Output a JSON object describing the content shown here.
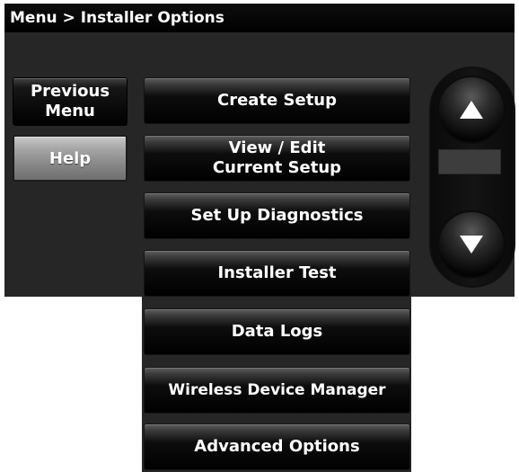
{
  "title_bar": {
    "breadcrumb": "Menu > Installer Options"
  },
  "side_buttons": {
    "previous_menu_line1": "Previous",
    "previous_menu_line2": "Menu",
    "help": "Help"
  },
  "menu_items": [
    {
      "line1": "Create Setup",
      "line2": ""
    },
    {
      "line1": "View / Edit",
      "line2": "Current Setup"
    },
    {
      "line1": "Set Up Diagnostics",
      "line2": ""
    },
    {
      "line1": "Installer Test",
      "line2": ""
    },
    {
      "line1": "Data Logs",
      "line2": ""
    },
    {
      "line1": "Wireless Device Manager",
      "line2": ""
    },
    {
      "line1": "Advanced Options",
      "line2": ""
    }
  ],
  "scroll": {
    "up_icon": "arrow-up-icon",
    "down_icon": "arrow-down-icon"
  }
}
